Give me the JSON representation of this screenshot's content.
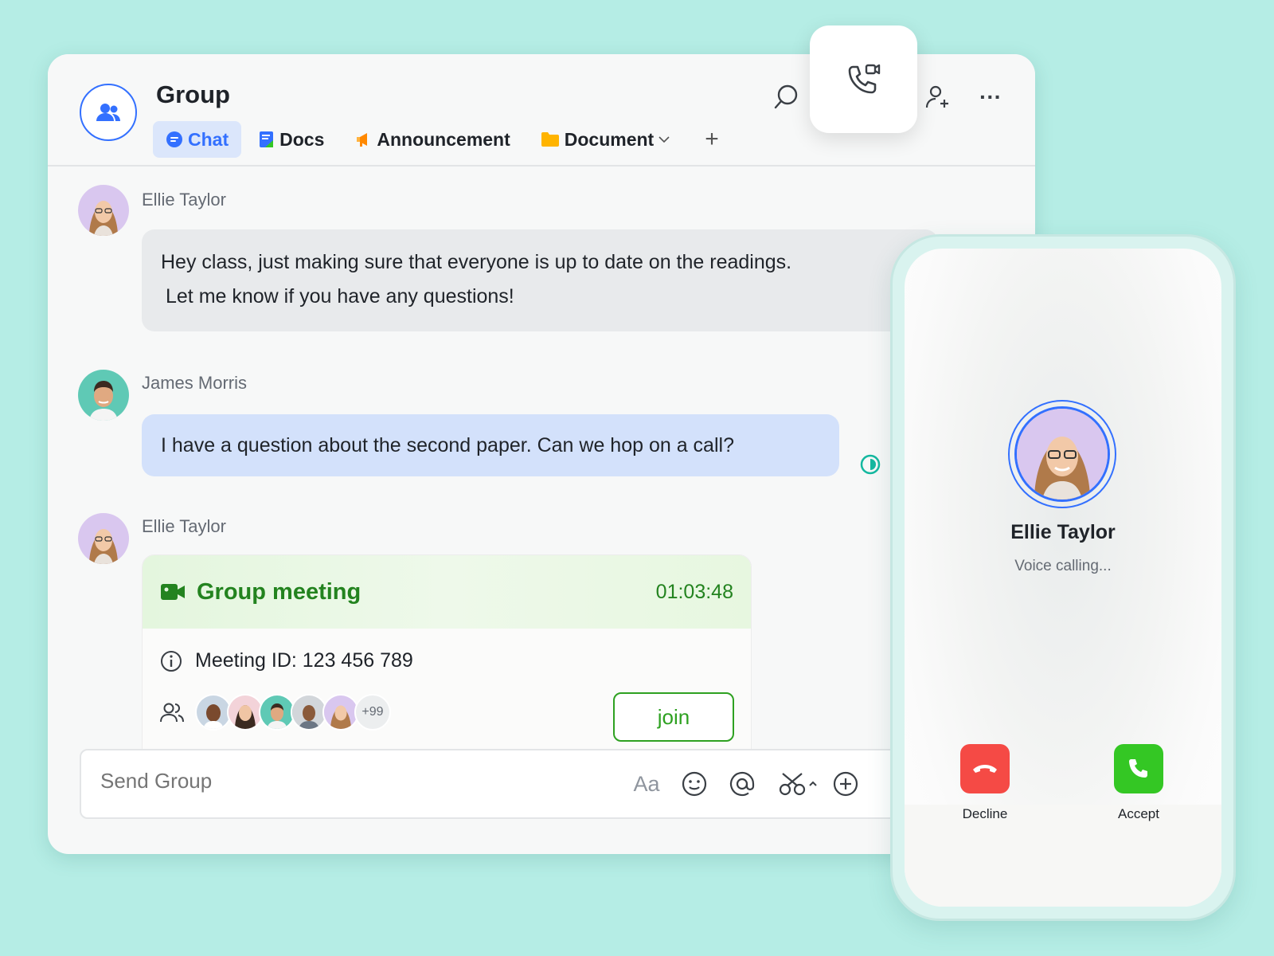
{
  "header": {
    "title": "Group",
    "tabs": [
      {
        "label": "Chat",
        "icon": "chat-bubble-icon",
        "active": true
      },
      {
        "label": "Docs",
        "icon": "docs-icon"
      },
      {
        "label": "Announcement",
        "icon": "megaphone-icon"
      },
      {
        "label": "Document",
        "icon": "folder-icon",
        "has_dropdown": true
      }
    ],
    "add_tab_label": "+",
    "more_label": "···"
  },
  "messages": [
    {
      "sender": "Ellie Taylor",
      "text_line1": "Hey class, just making sure that everyone is up to date on the readings.",
      "text_line2": "Let me know if you have any questions!"
    },
    {
      "sender": "James Morris",
      "text": "I have a question about the second paper. Can we hop on a call?"
    },
    {
      "sender": "Ellie Taylor"
    }
  ],
  "meeting": {
    "title": "Group meeting",
    "timer": "01:03:48",
    "id_text": "Meeting ID: 123 456 789",
    "more_participants": "+99",
    "join_label": "join"
  },
  "composer": {
    "placeholder": "Send Group",
    "format_label": "Aa"
  },
  "call": {
    "caller_name": "Ellie Taylor",
    "status": "Voice calling...",
    "decline_label": "Decline",
    "accept_label": "Accept"
  },
  "colors": {
    "background": "#b5ede5",
    "accent_blue": "#3370ff",
    "meeting_green": "#23831f",
    "decline_red": "#f54a45",
    "accept_green": "#34c724"
  }
}
